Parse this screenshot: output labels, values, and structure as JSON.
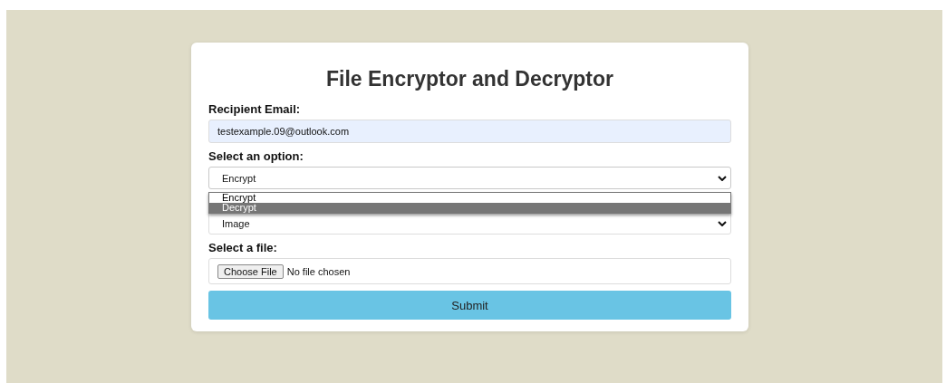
{
  "title": "File Encryptor and Decryptor",
  "email": {
    "label": "Recipient Email:",
    "value": "testexample.09@outlook.com"
  },
  "option": {
    "label": "Select an option:",
    "value": "Encrypt",
    "expanded": true,
    "options": [
      {
        "label": "Encrypt",
        "selected": true,
        "highlighted": false
      },
      {
        "label": "Decrypt",
        "selected": false,
        "highlighted": true
      }
    ]
  },
  "type_select": {
    "value": "Image"
  },
  "file": {
    "label": "Select a file:",
    "button": "Choose File",
    "status": "No file chosen"
  },
  "submit": "Submit"
}
